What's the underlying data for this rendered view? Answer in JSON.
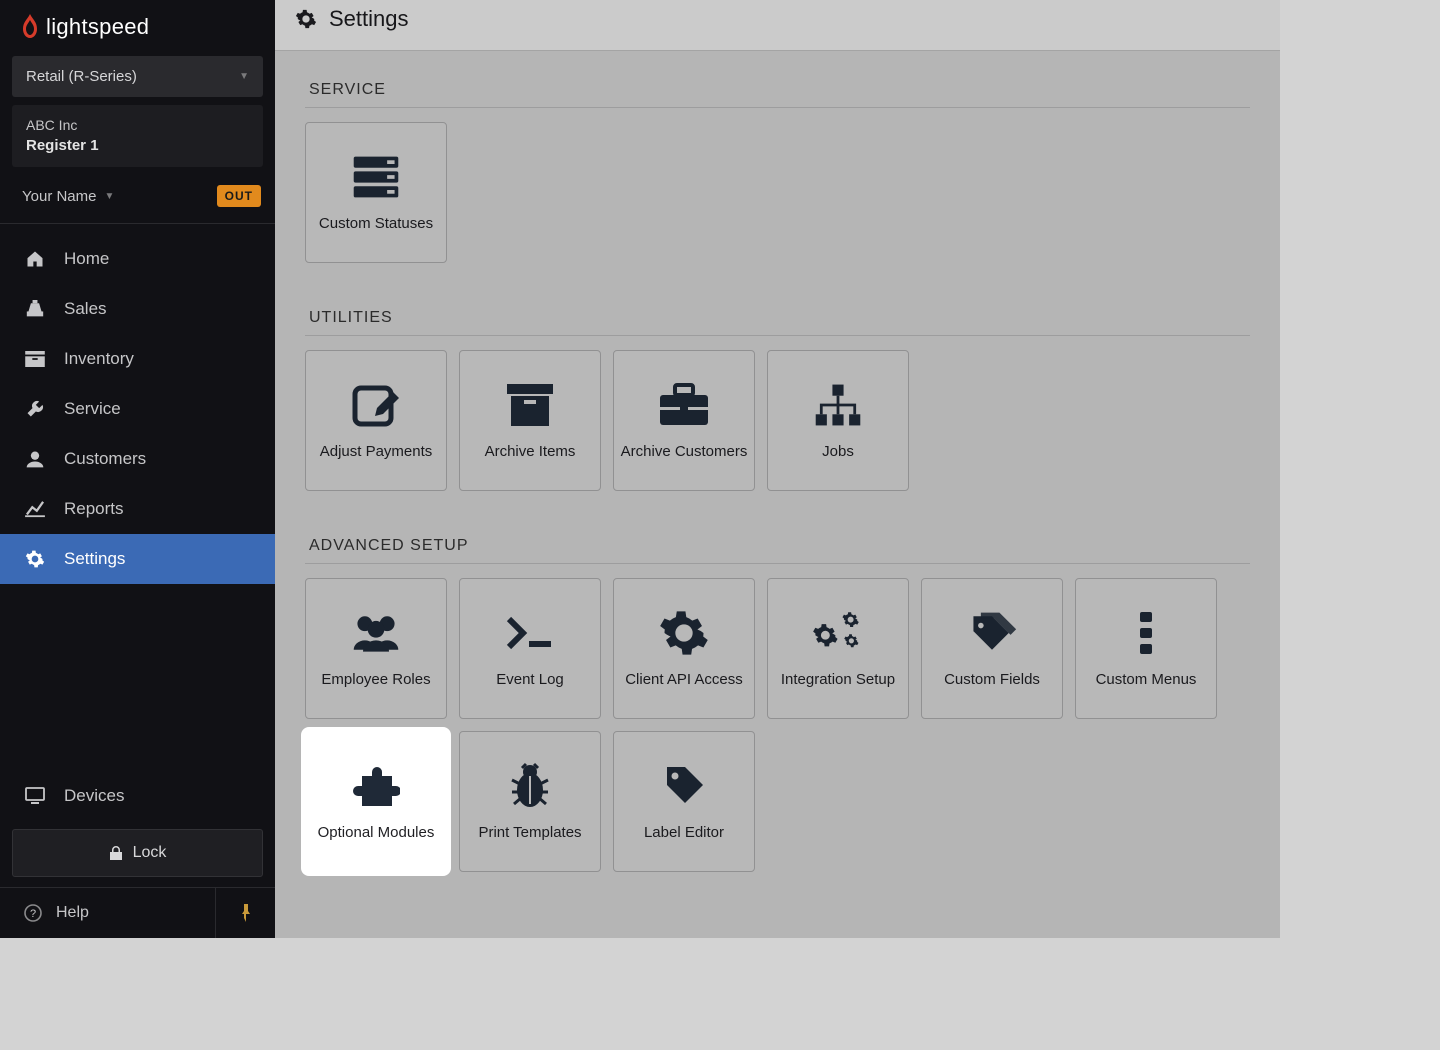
{
  "brand": "lightspeed",
  "productSelector": "Retail (R-Series)",
  "org": {
    "name": "ABC Inc",
    "register": "Register 1"
  },
  "user": {
    "name": "Your Name",
    "statusBadge": "OUT"
  },
  "nav": {
    "items": [
      {
        "label": "Home",
        "icon": "home"
      },
      {
        "label": "Sales",
        "icon": "register"
      },
      {
        "label": "Inventory",
        "icon": "inventory"
      },
      {
        "label": "Service",
        "icon": "wrench"
      },
      {
        "label": "Customers",
        "icon": "user"
      },
      {
        "label": "Reports",
        "icon": "chart"
      },
      {
        "label": "Settings",
        "icon": "gear",
        "active": true
      }
    ]
  },
  "sidebarBottom": {
    "devices": "Devices",
    "lock": "Lock",
    "help": "Help"
  },
  "page": {
    "title": "Settings",
    "sections": [
      {
        "title": "SERVICE",
        "tiles": [
          {
            "label": "Custom Statuses",
            "icon": "server"
          }
        ]
      },
      {
        "title": "UTILITIES",
        "tiles": [
          {
            "label": "Adjust Payments",
            "icon": "edit"
          },
          {
            "label": "Archive Items",
            "icon": "archive"
          },
          {
            "label": "Archive Customers",
            "icon": "briefcase"
          },
          {
            "label": "Jobs",
            "icon": "sitemap"
          }
        ]
      },
      {
        "title": "ADVANCED SETUP",
        "tiles": [
          {
            "label": "Employee Roles",
            "icon": "users"
          },
          {
            "label": "Event Log",
            "icon": "terminal"
          },
          {
            "label": "Client API Access",
            "icon": "gear-big"
          },
          {
            "label": "Integration Setup",
            "icon": "gears"
          },
          {
            "label": "Custom Fields",
            "icon": "tags"
          },
          {
            "label": "Custom Menus",
            "icon": "menu-dots"
          },
          {
            "label": "Optional Modules",
            "icon": "puzzle",
            "highlight": true
          },
          {
            "label": "Print Templates",
            "icon": "bug"
          },
          {
            "label": "Label Editor",
            "icon": "tag"
          }
        ]
      }
    ]
  }
}
